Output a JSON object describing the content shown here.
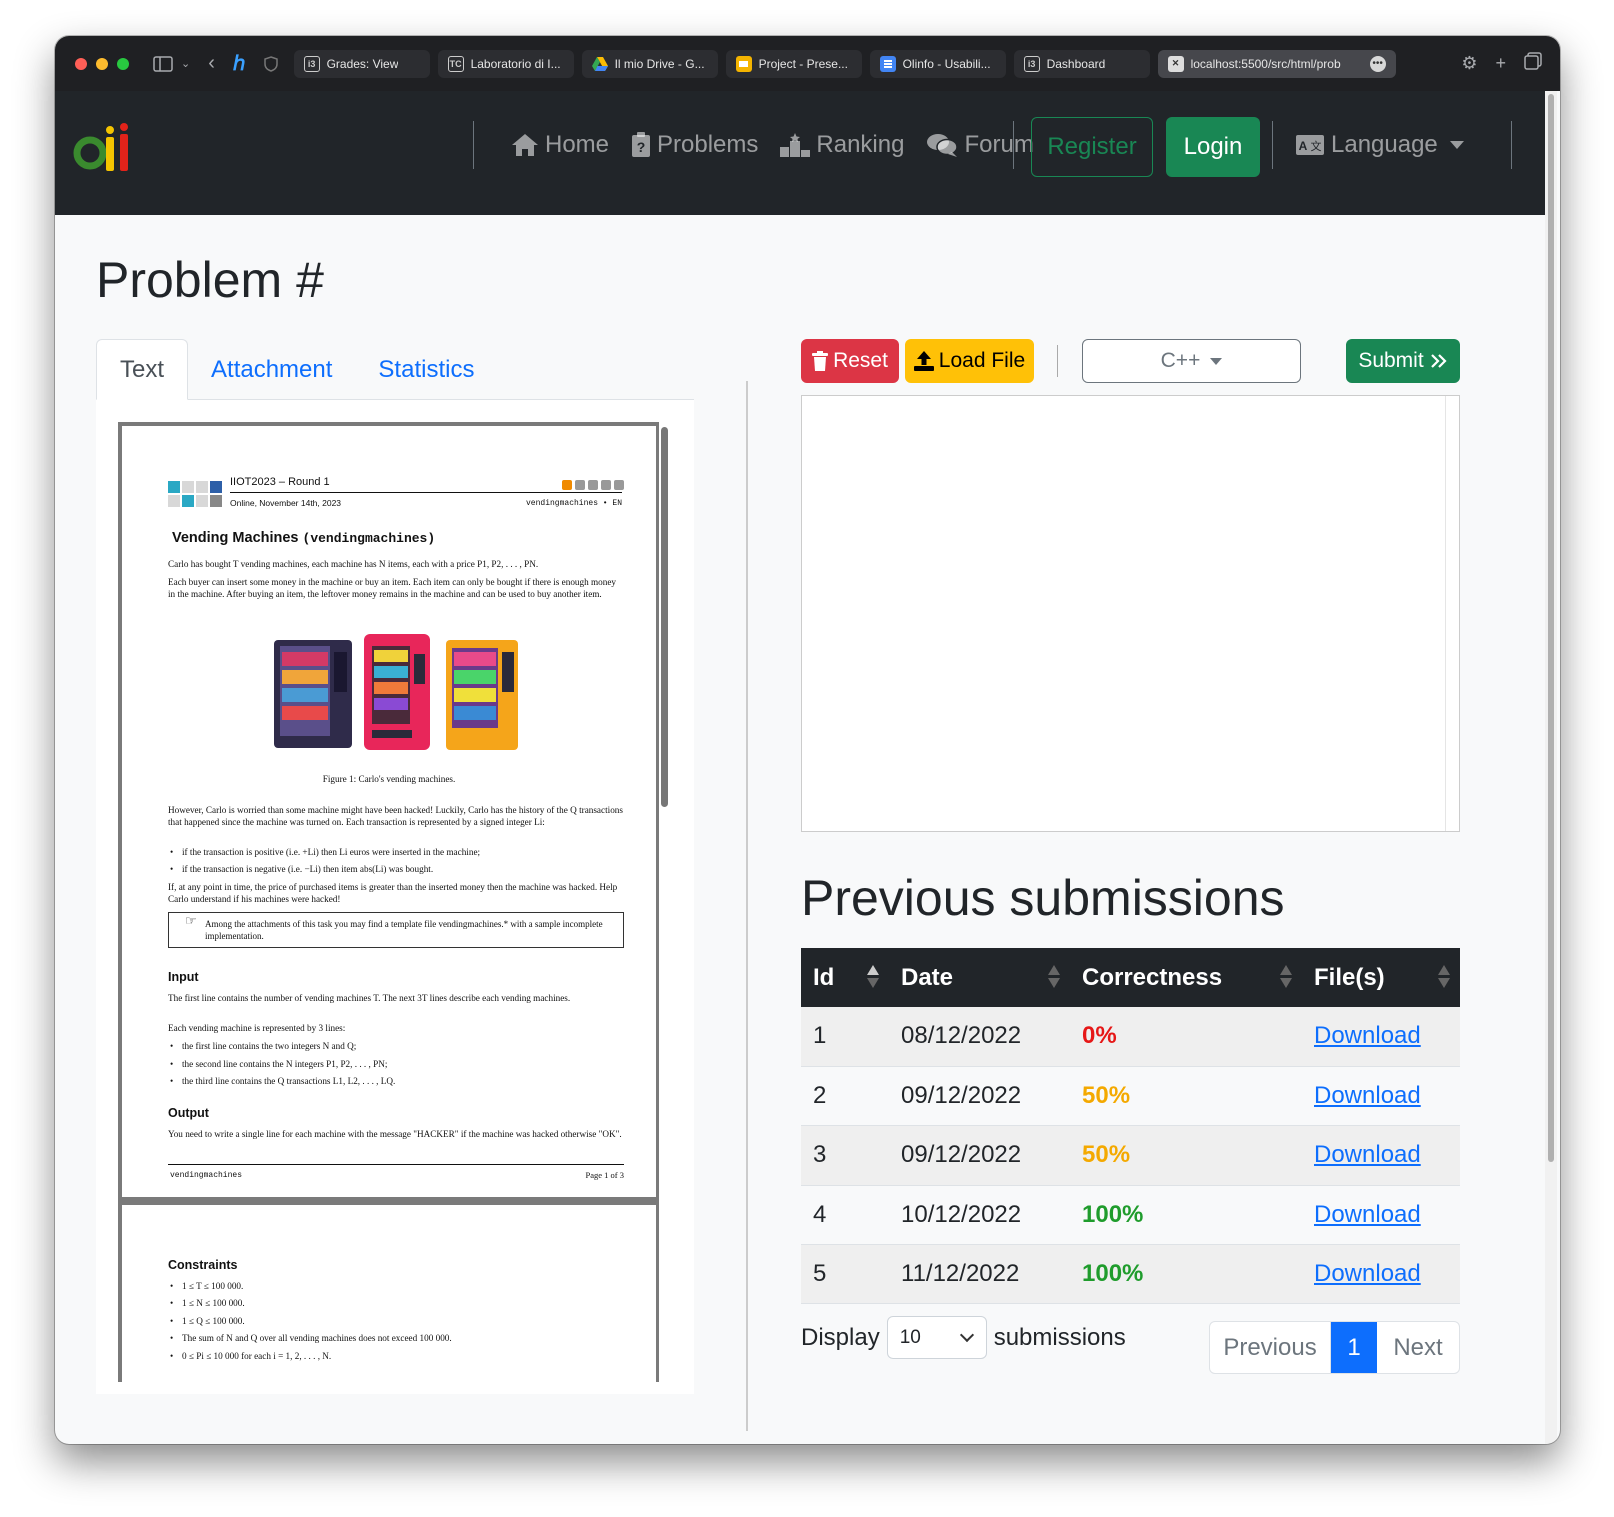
{
  "browser": {
    "tabs": [
      {
        "label": "Grades: View",
        "icon": "i3-icon"
      },
      {
        "label": "Laboratorio di I...",
        "icon": "tc-icon"
      },
      {
        "label": "Il mio Drive - G...",
        "icon": "google-drive-icon"
      },
      {
        "label": "Project - Prese...",
        "icon": "google-slides-icon"
      },
      {
        "label": "Olinfo - Usabili...",
        "icon": "google-docs-icon"
      },
      {
        "label": "Dashboard",
        "icon": "i3-icon"
      }
    ],
    "active_tab": {
      "label": "localhost:5500/src/html/prob",
      "icon": "local-file-icon"
    }
  },
  "nav": {
    "home": "Home",
    "problems": "Problems",
    "ranking": "Ranking",
    "forum": "Forum",
    "register": "Register",
    "login": "Login",
    "language": "Language"
  },
  "page_title": "Problem #",
  "left_tabs": {
    "text": "Text",
    "attachment": "Attachment",
    "statistics": "Statistics"
  },
  "pdf": {
    "header_title": "IIOT2023 – Round 1",
    "header_date": "Online, November 14th, 2023",
    "header_task": "vendingmachines • EN",
    "task_title": "Vending Machines",
    "task_code": "(vendingmachines)",
    "p1": "Carlo has bought T vending machines, each machine has N items, each with a price P1, P2, . . . , PN.",
    "p2": "Each buyer can insert some money in the machine or buy an item. Each item can only be bought if there is enough money in the machine. After buying an item, the leftover money remains in the machine and can be used to buy another item.",
    "figure_caption": "Figure 1: Carlo's vending machines.",
    "p3": "However, Carlo is worried than some machine might have been hacked! Luckily, Carlo has the history of the Q transactions that happened since the machine was turned on. Each transaction is represented by a signed integer Li:",
    "b1": "if the transaction is positive (i.e. +Li) then Li euros were inserted in the machine;",
    "b2": "if the transaction is negative (i.e. −Li) then item abs(Li) was bought.",
    "p4": "If, at any point in time, the price of purchased items is greater than the inserted money then the machine was hacked. Help Carlo understand if his machines were hacked!",
    "note": "Among the attachments of this task you may find a template file vendingmachines.* with a sample incomplete implementation.",
    "input_h": "Input",
    "input_p": "The first line contains the number of vending machines T. The next 3T lines describe each vending machines.",
    "input_p2": "Each vending machine is represented by 3 lines:",
    "ib1": "the first line contains the two integers N and Q;",
    "ib2": "the second line contains the N integers P1, P2, . . . , PN;",
    "ib3": "the third line contains the Q transactions L1, L2, . . . , LQ.",
    "output_h": "Output",
    "output_p": "You need to write a single line for each machine with the message \"HACKER\" if the machine was hacked otherwise \"OK\".",
    "footer_left": "vendingmachines",
    "footer_right": "Page 1 of 3",
    "constraints_h": "Constraints",
    "c1": "1 ≤ T ≤ 100 000.",
    "c2": "1 ≤ N ≤ 100 000.",
    "c3": "1 ≤ Q ≤ 100 000.",
    "c4": "The sum of N and Q over all vending machines does not exceed 100 000.",
    "c5": "0 ≤ Pi ≤ 10 000 for each i = 1, 2, . . . , N."
  },
  "editor": {
    "reset": "Reset",
    "load_file": "Load File",
    "language": "C++",
    "submit": "Submit"
  },
  "submissions": {
    "title": "Previous submissions",
    "columns": [
      "Id",
      "Date",
      "Correctness",
      "File(s)"
    ],
    "rows": [
      {
        "id": "1",
        "date": "08/12/2022",
        "correctness": "0%",
        "file": "Download"
      },
      {
        "id": "2",
        "date": "09/12/2022",
        "correctness": "50%",
        "file": "Download"
      },
      {
        "id": "3",
        "date": "09/12/2022",
        "correctness": "50%",
        "file": "Download"
      },
      {
        "id": "4",
        "date": "10/12/2022",
        "correctness": "100%",
        "file": "Download"
      },
      {
        "id": "5",
        "date": "11/12/2022",
        "correctness": "100%",
        "file": "Download"
      }
    ],
    "display_prefix": "Display",
    "display_value": "10",
    "display_suffix": "submissions",
    "pagination": {
      "previous": "Previous",
      "page": "1",
      "next": "Next"
    }
  },
  "colors": {
    "navbar": "#212529",
    "success": "#198754",
    "danger": "#dc3545",
    "warning": "#ffc107",
    "primary": "#0d6efd",
    "correct_0": "#e61717",
    "correct_50": "#f4a900",
    "correct_100": "#1f9c2c"
  }
}
